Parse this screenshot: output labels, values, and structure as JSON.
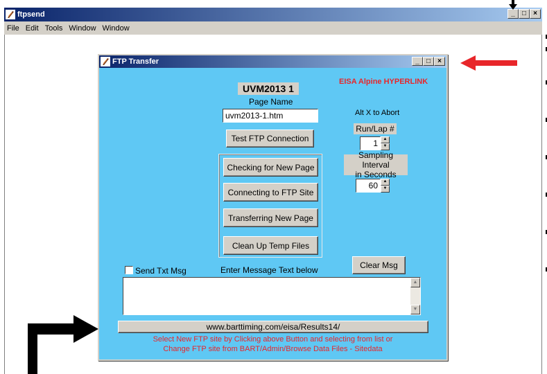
{
  "app": {
    "title": "ftpsend",
    "menu": [
      "File",
      "Edit",
      "Tools",
      "Window",
      "Window"
    ],
    "controls": {
      "minimize": "_",
      "maximize": "□",
      "close": "×"
    }
  },
  "dialog": {
    "title": "FTP Transfer",
    "controls": {
      "minimize": "_",
      "maximize": "□",
      "close": "×"
    },
    "hyperlink_label": "EISA Alpine  HYPERLINK",
    "page_title": "UVM2013 1",
    "page_name_label": "Page Name",
    "page_name_value": "uvm2013-1.htm",
    "test_ftp_button": "Test FTP Connection",
    "abort_hint": "Alt X to Abort",
    "run_lap_label": "Run/Lap #",
    "run_lap_value": "1",
    "sampling_label_line1": "Sampling Interval",
    "sampling_label_line2": "in Seconds",
    "sampling_value": "60",
    "steps": [
      "Checking for New Page",
      "Connecting to FTP Site",
      "Transferring New Page",
      "Clean Up Temp Files"
    ],
    "send_txt_label": "Send Txt Msg",
    "message_label": "Enter Message Text below",
    "clear_msg_button": "Clear Msg",
    "message_text": "",
    "ftp_site_button": "www.barttiming.com/eisa/Results14/",
    "footer_line1": "Select New FTP site by Clicking above Button and selecting from list or",
    "footer_line2": "Change FTP site from BART/Admin/Browse Data Files - Sitedata"
  },
  "colors": {
    "dialog_bg": "#5fc8f4",
    "accent_red": "#e8262a",
    "arrow_red": "#e8262a",
    "arrow_black": "#000000",
    "titlebar_start": "#0a246a",
    "titlebar_end": "#a6caf0"
  }
}
